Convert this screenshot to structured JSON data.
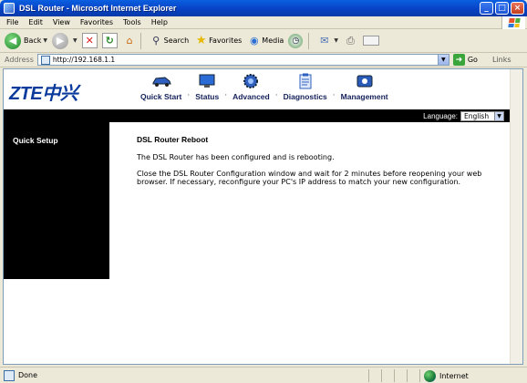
{
  "window": {
    "title": "DSL Router - Microsoft Internet Explorer",
    "controls": [
      "_",
      "□",
      "×"
    ]
  },
  "menu": [
    "File",
    "Edit",
    "View",
    "Favorites",
    "Tools",
    "Help"
  ],
  "toolbar": {
    "back": "Back",
    "search": "Search",
    "favorites": "Favorites",
    "media": "Media"
  },
  "address": {
    "label": "Address",
    "url": "http://192.168.1.1",
    "go": "Go",
    "links": "Links"
  },
  "router": {
    "logo": "ZTE中兴",
    "nav": [
      {
        "label": "Quick Start",
        "icon": "car-icon"
      },
      {
        "label": "Status",
        "icon": "monitor-icon"
      },
      {
        "label": "Advanced",
        "icon": "gear-icon"
      },
      {
        "label": "Diagnostics",
        "icon": "clipboard-icon"
      },
      {
        "label": "Management",
        "icon": "management-icon"
      }
    ],
    "language_label": "Language:",
    "language_value": "English",
    "sidebar": [
      "Quick Setup"
    ],
    "content": {
      "title": "DSL Router Reboot",
      "para1": "The DSL Router has been configured and is rebooting.",
      "para2": "Close the DSL Router Configuration window and wait for 2 minutes before reopening your web browser. If necessary, reconfigure your PC's IP address to match your new configuration."
    }
  },
  "status": {
    "text": "Done",
    "zone": "Internet"
  }
}
